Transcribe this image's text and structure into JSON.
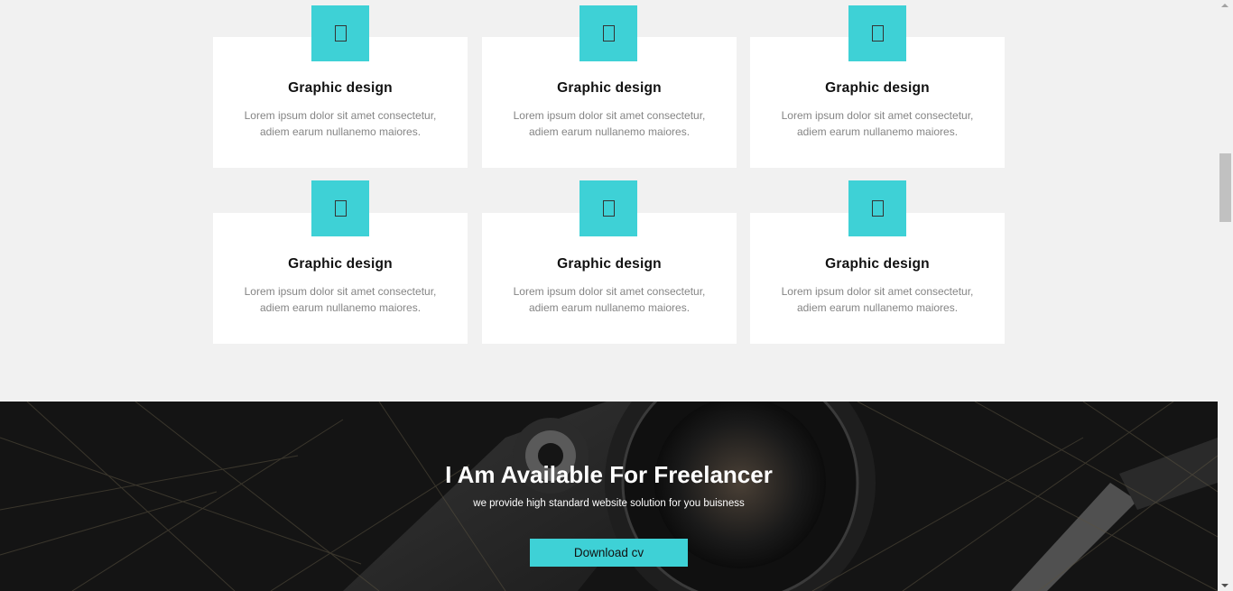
{
  "services": {
    "cards": [
      {
        "title": "Graphic design",
        "line1": "Lorem ipsum dolor sit amet consectetur,",
        "line2": "adiem earum nullanemo maiores.",
        "icon": "service-icon"
      },
      {
        "title": "Graphic design",
        "line1": "Lorem ipsum dolor sit amet consectetur,",
        "line2": "adiem earum nullanemo maiores.",
        "icon": "service-icon"
      },
      {
        "title": "Graphic design",
        "line1": "Lorem ipsum dolor sit amet consectetur,",
        "line2": "adiem earum nullanemo maiores.",
        "icon": "service-icon"
      },
      {
        "title": "Graphic design",
        "line1": "Lorem ipsum dolor sit amet consectetur,",
        "line2": "adiem earum nullanemo maiores.",
        "icon": "service-icon"
      },
      {
        "title": "Graphic design",
        "line1": "Lorem ipsum dolor sit amet consectetur,",
        "line2": "adiem earum nullanemo maiores.",
        "icon": "service-icon"
      },
      {
        "title": "Graphic design",
        "line1": "Lorem ipsum dolor sit amet consectetur,",
        "line2": "adiem earum nullanemo maiores.",
        "icon": "service-icon"
      }
    ]
  },
  "banner": {
    "title": "I Am Available For Freelancer",
    "subtitle": "we provide high standard website solution for you buisness",
    "button_label": "Download cv"
  },
  "colors": {
    "accent": "#3ed1d6",
    "page_bg": "#f1f1f1",
    "banner_bg": "#121212"
  }
}
